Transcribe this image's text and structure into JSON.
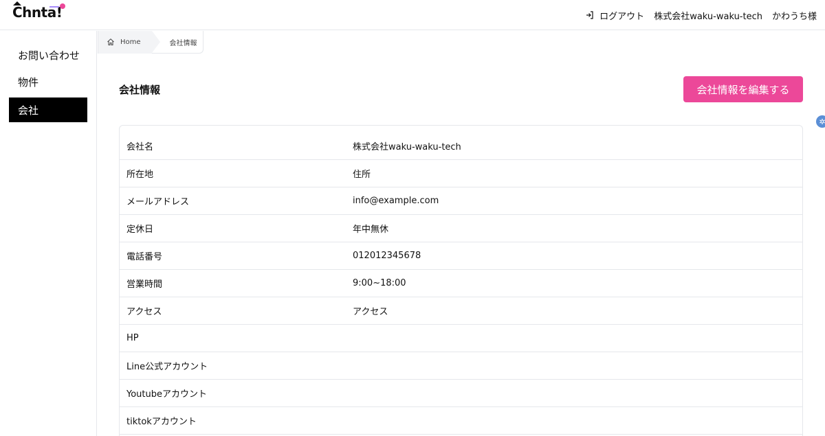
{
  "header": {
    "logo_text": "Chnta!",
    "logout_label": "ログアウト",
    "company_name": "株式会社waku-waku-tech",
    "user_name": "かわうち様"
  },
  "sidebar": {
    "items": [
      {
        "label": "お問い合わせ"
      },
      {
        "label": "物件"
      },
      {
        "label": "会社"
      }
    ]
  },
  "breadcrumb": {
    "home": "Home",
    "current": "会社情報"
  },
  "main": {
    "title": "会社情報",
    "edit_button": "会社情報を編集する"
  },
  "company_info": {
    "rows": [
      {
        "label": "会社名",
        "value": "株式会社waku-waku-tech"
      },
      {
        "label": "所在地",
        "value": "住所"
      },
      {
        "label": "メールアドレス",
        "value": "info@example.com"
      },
      {
        "label": "定休日",
        "value": "年中無休"
      },
      {
        "label": "電話番号",
        "value": "012012345678"
      },
      {
        "label": "営業時間",
        "value": "9:00~18:00"
      },
      {
        "label": "アクセス",
        "value": "アクセス"
      },
      {
        "label": "HP",
        "value": ""
      },
      {
        "label": "Line公式アカウント",
        "value": ""
      },
      {
        "label": "Youtubeアカウント",
        "value": ""
      },
      {
        "label": "tiktokアカウント",
        "value": ""
      }
    ]
  },
  "colors": {
    "accent": "#ec4899",
    "active_nav": "#000000",
    "border": "#e5e7eb"
  }
}
